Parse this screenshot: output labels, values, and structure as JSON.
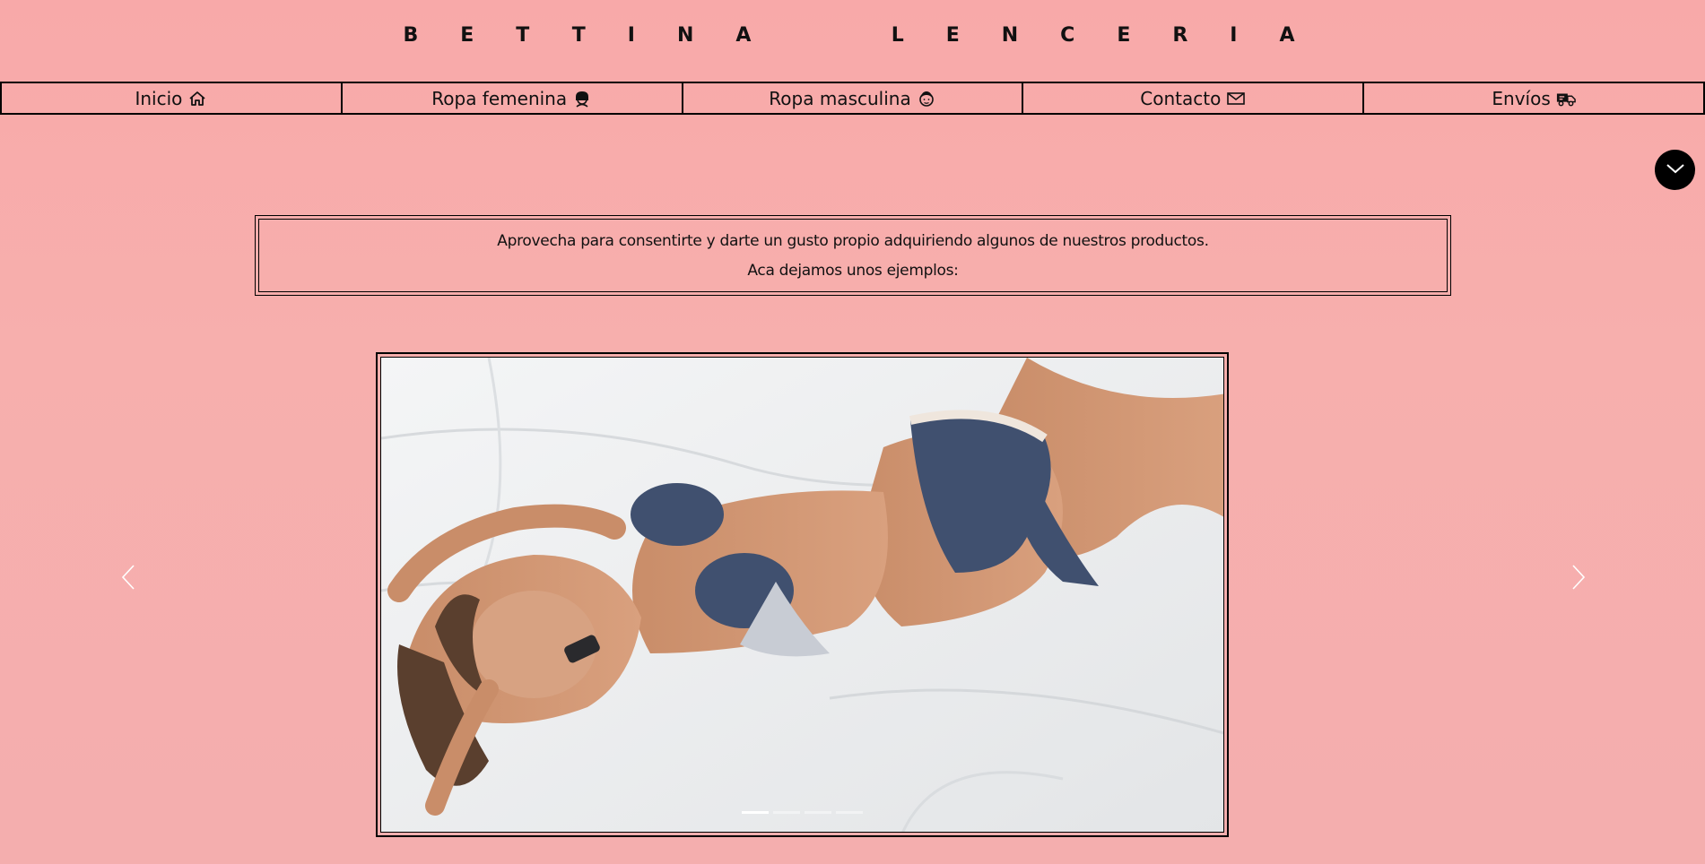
{
  "brand": {
    "title": "BETTINA  LENCERIA"
  },
  "nav": {
    "items": [
      {
        "label": "Inicio",
        "icon": "home-icon"
      },
      {
        "label": "Ropa femenina",
        "icon": "woman-icon"
      },
      {
        "label": "Ropa masculina",
        "icon": "man-icon"
      },
      {
        "label": "Contacto",
        "icon": "mail-icon"
      },
      {
        "label": "Envíos",
        "icon": "truck-icon"
      }
    ]
  },
  "promo": {
    "line1": "Aprovecha para consentirte y darte un gusto propio adquiriendo algunos de nuestros productos.",
    "line2": "Aca dejamos unos ejemplos:"
  },
  "slider": {
    "slide_count": 4,
    "active_index": 0,
    "image": "lingerie-model-photo"
  },
  "colors": {
    "background": "#f8a9a9",
    "text": "#111111",
    "accent": "#000000"
  }
}
